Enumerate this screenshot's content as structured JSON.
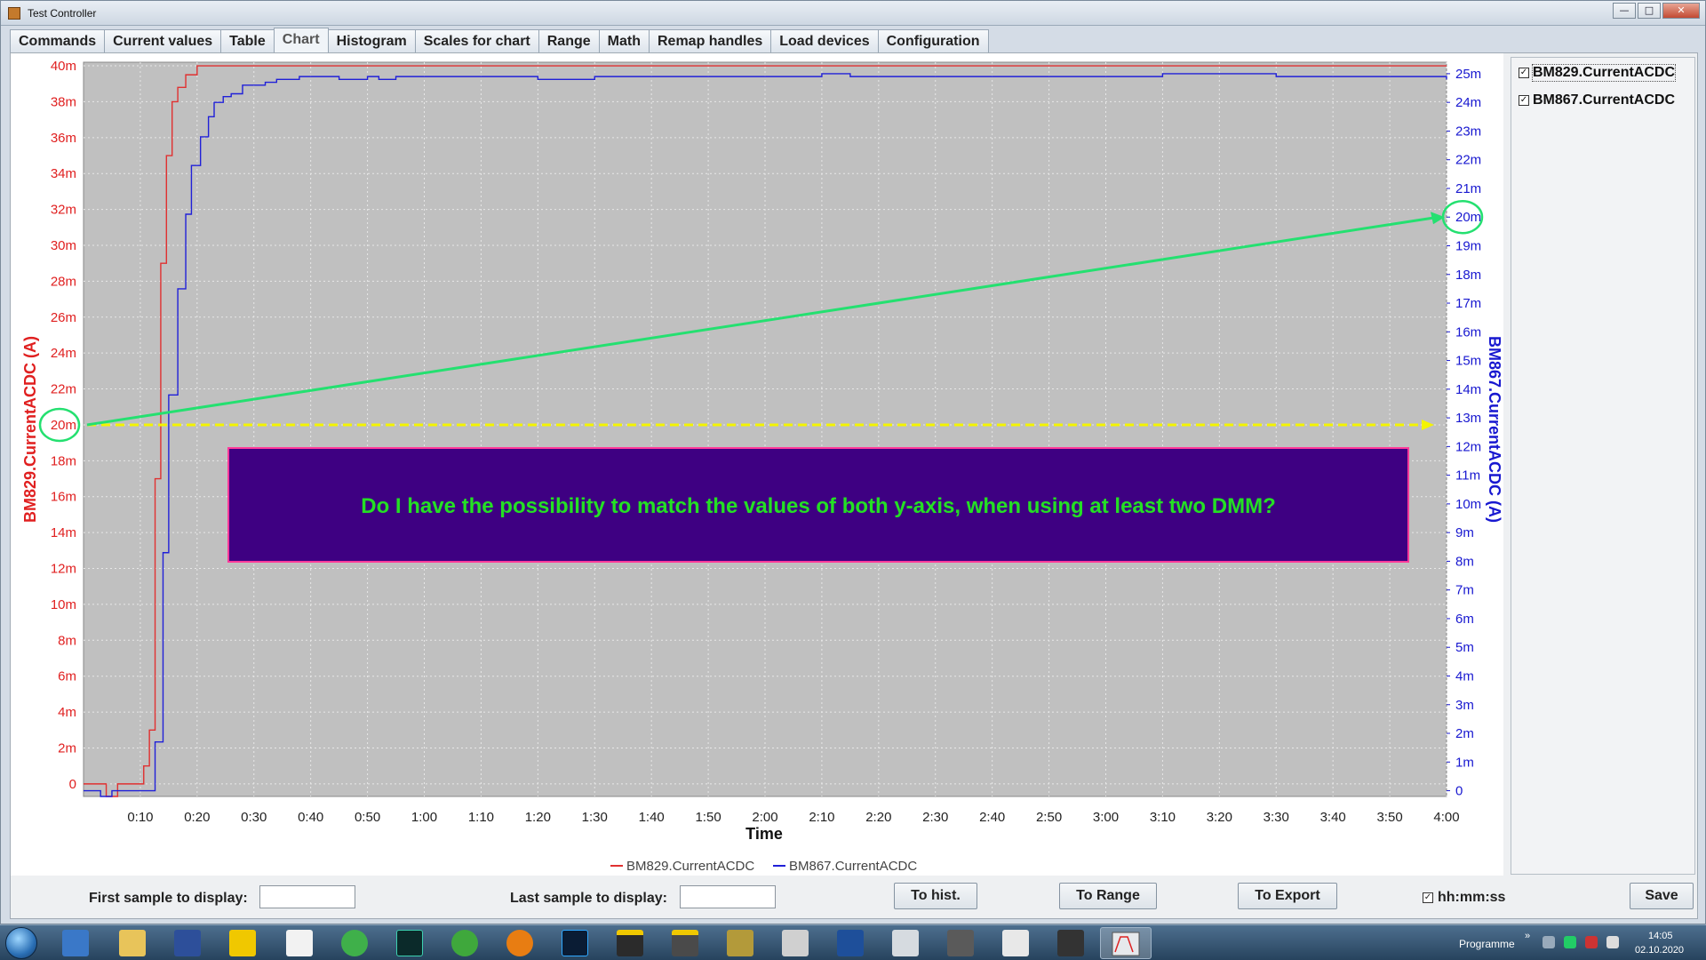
{
  "window": {
    "title": "Test Controller",
    "minimize": "—",
    "maximize": "□",
    "close": "✕"
  },
  "tabs": [
    {
      "label": "Commands"
    },
    {
      "label": "Current values"
    },
    {
      "label": "Table"
    },
    {
      "label": "Chart"
    },
    {
      "label": "Histogram"
    },
    {
      "label": "Scales for chart"
    },
    {
      "label": "Range"
    },
    {
      "label": "Math"
    },
    {
      "label": "Remap handles"
    },
    {
      "label": "Load devices"
    },
    {
      "label": "Configuration"
    }
  ],
  "active_tab": "Chart",
  "series_panel": {
    "items": [
      {
        "label": "BM829.CurrentACDC",
        "checked": "✓"
      },
      {
        "label": "BM867.CurrentACDC",
        "checked": "✓"
      }
    ]
  },
  "annotation": {
    "text": "Do I have the possibility to match the values of both y-axis, when using at least two DMM?",
    "box_color": "#3e0082",
    "text_color": "#24e024",
    "arrow_color": "#24e070",
    "dashed_color": "#f4f400"
  },
  "chart_data": {
    "type": "line",
    "xlabel": "Time",
    "x_ticks": [
      "0:10",
      "0:20",
      "0:30",
      "0:40",
      "0:50",
      "1:00",
      "1:10",
      "1:20",
      "1:30",
      "1:40",
      "1:50",
      "2:00",
      "2:10",
      "2:20",
      "2:30",
      "2:40",
      "2:50",
      "3:00",
      "3:10",
      "3:20",
      "3:30",
      "3:40",
      "3:50",
      "4:00"
    ],
    "xlim": [
      0,
      240
    ],
    "left_axis": {
      "label": "BM829.CurrentACDC (A)",
      "color": "#e02020",
      "ticks": [
        "0",
        "2m",
        "4m",
        "6m",
        "8m",
        "10m",
        "12m",
        "14m",
        "16m",
        "18m",
        "20m",
        "22m",
        "24m",
        "26m",
        "28m",
        "30m",
        "32m",
        "34m",
        "36m",
        "38m",
        "40m"
      ],
      "ylim": [
        -0.0007,
        0.0402
      ]
    },
    "right_axis": {
      "label": "BM867.CurrentACDC (A)",
      "color": "#1818d0",
      "ticks": [
        "0",
        "1m",
        "2m",
        "3m",
        "4m",
        "5m",
        "6m",
        "7m",
        "8m",
        "9m",
        "10m",
        "11m",
        "12m",
        "13m",
        "14m",
        "15m",
        "16m",
        "17m",
        "18m",
        "19m",
        "20m",
        "21m",
        "22m",
        "23m",
        "24m",
        "25m"
      ],
      "ylim": [
        -0.0002,
        0.0254
      ]
    },
    "grid": true,
    "legend_position": "bottom",
    "series": [
      {
        "name": "BM829.CurrentACDC",
        "color": "#e03030",
        "axis": "left",
        "x": [
          0,
          3,
          4,
          5,
          6,
          8,
          10,
          10.6,
          11,
          11.6,
          12,
          12.6,
          13,
          13.6,
          14,
          14.6,
          15,
          15.6,
          16,
          16.6,
          17,
          18,
          19,
          20,
          240
        ],
        "y": [
          0,
          0,
          -0.0007,
          -0.0007,
          0,
          0,
          0,
          0.001,
          0.001,
          0.003,
          0.003,
          0.017,
          0.017,
          0.029,
          0.029,
          0.035,
          0.035,
          0.038,
          0.038,
          0.0388,
          0.0388,
          0.0395,
          0.0395,
          0.04,
          0.04
        ]
      },
      {
        "name": "BM867.CurrentACDC",
        "color": "#2020d8",
        "axis": "right",
        "x": [
          0,
          2,
          3,
          4,
          5,
          6,
          8,
          11,
          12,
          12.6,
          13,
          14,
          14.6,
          15,
          16,
          16.6,
          17,
          18,
          18.6,
          19,
          20,
          20.6,
          21,
          22,
          22.6,
          23,
          24,
          24.6,
          25,
          26,
          27,
          28,
          29,
          30,
          32,
          34,
          36,
          38,
          40,
          45,
          50,
          52,
          55,
          60,
          65,
          70,
          75,
          80,
          90,
          100,
          110,
          120,
          130,
          135,
          140,
          145,
          150,
          155,
          160,
          170,
          180,
          190,
          200,
          210,
          215,
          220,
          230,
          240
        ],
        "y": [
          0,
          0,
          -0.0002,
          -0.0002,
          0,
          0,
          0,
          0,
          0,
          0.0017,
          0.0017,
          0.0083,
          0.0083,
          0.0138,
          0.0138,
          0.0175,
          0.0175,
          0.0201,
          0.0201,
          0.0218,
          0.0218,
          0.0228,
          0.0228,
          0.0235,
          0.0235,
          0.024,
          0.024,
          0.0242,
          0.0242,
          0.0243,
          0.0243,
          0.0246,
          0.0246,
          0.0246,
          0.0247,
          0.0248,
          0.0248,
          0.0249,
          0.0249,
          0.0248,
          0.0249,
          0.0248,
          0.0249,
          0.0249,
          0.0249,
          0.0249,
          0.0249,
          0.0248,
          0.0249,
          0.0249,
          0.0249,
          0.0249,
          0.025,
          0.0249,
          0.0249,
          0.0249,
          0.0249,
          0.0249,
          0.0249,
          0.0249,
          0.0249,
          0.025,
          0.025,
          0.0249,
          0.0249,
          0.0249,
          0.0249,
          0.0248
        ]
      }
    ],
    "highlight": {
      "left_value": "20m",
      "right_value": "20m"
    }
  },
  "controls": {
    "first_sample_label": "First sample to display:",
    "first_sample_value": "",
    "last_sample_label": "Last sample to display:",
    "last_sample_value": "",
    "to_hist": "To hist.",
    "to_range": "To Range",
    "to_export": "To Export",
    "hms_label": "hh:mm:ss",
    "hms_checked": "✓",
    "save": "Save"
  },
  "taskbar": {
    "programme_label": "Programme",
    "expand": "»",
    "time": "14:05",
    "date": "02.10.2020"
  }
}
